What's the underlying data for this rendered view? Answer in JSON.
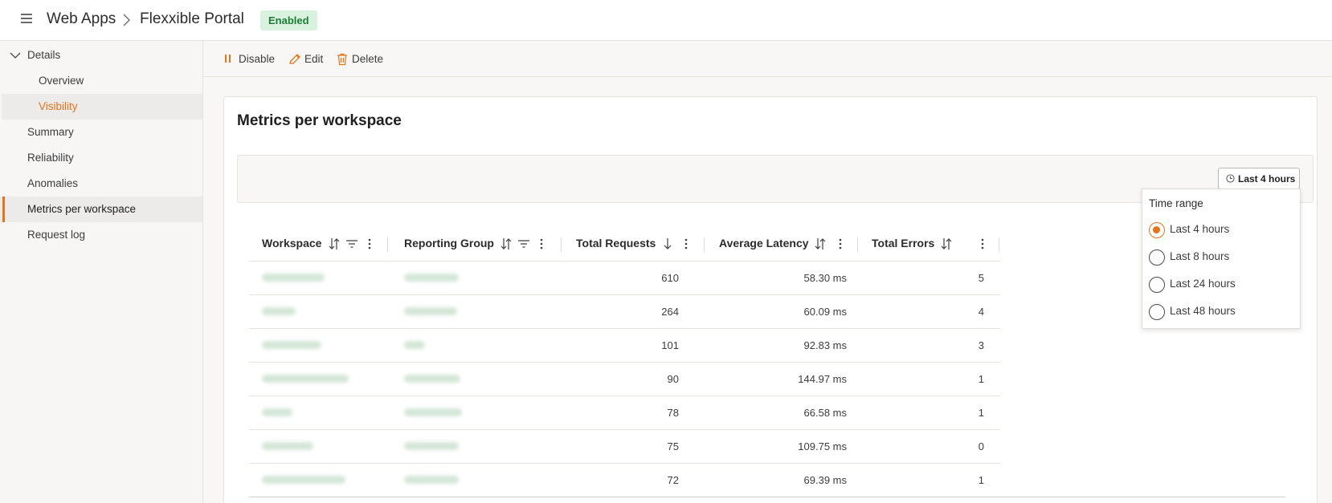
{
  "header": {
    "breadcrumb_root": "Web Apps",
    "breadcrumb_current": "Flexxible Portal",
    "status_badge": "Enabled"
  },
  "sidebar": {
    "group_label": "Details",
    "sub_items": [
      "Overview",
      "Visibility"
    ],
    "items": [
      "Summary",
      "Reliability",
      "Anomalies",
      "Metrics per workspace",
      "Request log"
    ],
    "active_sub": "Visibility",
    "selected_item": "Metrics per workspace"
  },
  "toolbar": {
    "disable_label": "Disable",
    "edit_label": "Edit",
    "delete_label": "Delete"
  },
  "main": {
    "title": "Metrics per workspace",
    "time_button_label": "Last 4 hours"
  },
  "table": {
    "columns": [
      "Workspace",
      "Reporting Group",
      "Total Requests",
      "Average Latency",
      "Total Errors"
    ],
    "rows": [
      {
        "total_requests": "610",
        "average_latency": "58.30 ms",
        "total_errors": "5"
      },
      {
        "total_requests": "264",
        "average_latency": "60.09 ms",
        "total_errors": "4"
      },
      {
        "total_requests": "101",
        "average_latency": "92.83 ms",
        "total_errors": "3"
      },
      {
        "total_requests": "90",
        "average_latency": "144.97 ms",
        "total_errors": "1"
      },
      {
        "total_requests": "78",
        "average_latency": "66.58 ms",
        "total_errors": "1"
      },
      {
        "total_requests": "75",
        "average_latency": "109.75 ms",
        "total_errors": "0"
      },
      {
        "total_requests": "72",
        "average_latency": "69.39 ms",
        "total_errors": "1"
      }
    ]
  },
  "time_range_popup": {
    "title": "Time range",
    "options": [
      "Last 4 hours",
      "Last 8 hours",
      "Last 24 hours",
      "Last 48 hours"
    ],
    "selected": "Last 4 hours"
  },
  "colors": {
    "accent": "#e5731a",
    "badge_bg": "#d9f2df",
    "badge_text": "#1e7b34"
  },
  "icons": [
    "hamburger-icon",
    "chevron-right-icon",
    "chevron-down-icon",
    "pause-icon",
    "pencil-icon",
    "trash-icon",
    "clock-icon",
    "sort-icon",
    "sort-down-icon",
    "filter-icon",
    "more-vertical-icon"
  ]
}
